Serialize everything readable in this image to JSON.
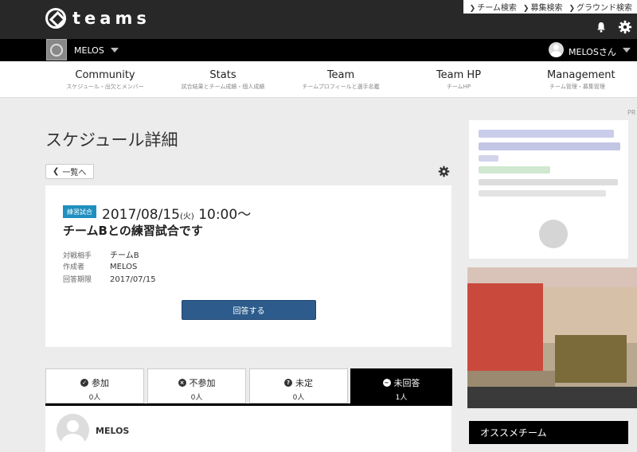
{
  "app": {
    "logo_text": "teams"
  },
  "top_links": [
    {
      "label": "チーム検索"
    },
    {
      "label": "募集検索"
    },
    {
      "label": "グラウンド検索"
    }
  ],
  "icons": {
    "bell": "bell-icon",
    "gear": "gear-icon",
    "chevron": "chevron-right-icon"
  },
  "team_bar": {
    "team_name": "MELOS",
    "user_name": "MELOSさん"
  },
  "nav": [
    {
      "title": "Community",
      "sub": "スケジュール・出欠とメンバー"
    },
    {
      "title": "Stats",
      "sub": "試合結果とチーム成績・個人成績"
    },
    {
      "title": "Team",
      "sub": "チームプロフィールと選手名鑑"
    },
    {
      "title": "Team HP",
      "sub": "チームHP"
    },
    {
      "title": "Management",
      "sub": "チーム管理・募集管理"
    }
  ],
  "pr_label": "PR",
  "page_title": "スケジュール詳細",
  "back_button": "一覧へ",
  "event": {
    "badge": "練習試合",
    "date": "2017/08/15",
    "dow": "(火)",
    "time": " 10:00〜",
    "title": "チームBとの練習試合です",
    "info": [
      {
        "key": "対戦相手",
        "value": "チームB"
      },
      {
        "key": "作成者",
        "value": "MELOS"
      },
      {
        "key": "回答期限",
        "value": "2017/07/15"
      }
    ],
    "answer_button": "回答する"
  },
  "tabs": [
    {
      "label": "参加",
      "count": "0人",
      "icon": "✓",
      "active": false
    },
    {
      "label": "不参加",
      "count": "0人",
      "icon": "×",
      "active": false
    },
    {
      "label": "未定",
      "count": "0人",
      "icon": "?",
      "active": false
    },
    {
      "label": "未回答",
      "count": "1人",
      "icon": "−",
      "active": true
    }
  ],
  "members": [
    {
      "name": "MELOS"
    }
  ],
  "sidebar": {
    "recommend_title": "オススメチーム"
  },
  "colors": {
    "header": "#282828",
    "teambar": "#000000",
    "badge": "#1f8fbf",
    "answer_button": "#2d5c8c"
  }
}
